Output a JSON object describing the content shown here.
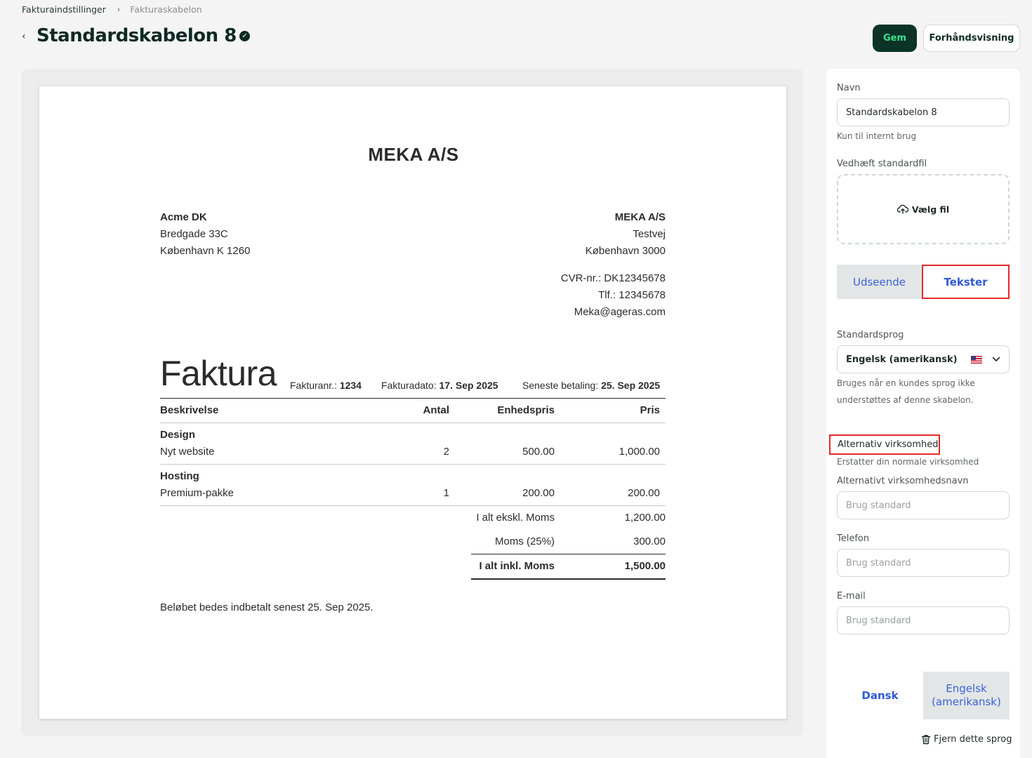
{
  "breadcrumb": {
    "root": "Fakturaindstillinger",
    "separator": "›",
    "current": "Fakturaskabelon"
  },
  "header": {
    "back": "‹",
    "title": "Standardskabelon 8",
    "verified_icon": "✓",
    "save": "Gem",
    "preview": "Forhåndsvisning"
  },
  "invoice": {
    "company_name": "MEKA A/S",
    "customer": {
      "name": "Acme DK",
      "street": "Bredgade 33C",
      "city": "København K 1260"
    },
    "sender": {
      "name": "MEKA A/S",
      "street": "Testvej",
      "city": "København 3000",
      "cvr": "CVR-nr.: DK12345678",
      "phone": "Tlf.: 12345678",
      "email": "Meka@ageras.com"
    },
    "heading": "Faktura",
    "meta": {
      "number_label": "Fakturanr.:",
      "number": "1234",
      "date_label": "Fakturadato:",
      "date": "17. Sep 2025",
      "due_label": "Seneste betaling:",
      "due": "25. Sep 2025"
    },
    "columns": {
      "description": "Beskrivelse",
      "qty": "Antal",
      "unit_price": "Enhedspris",
      "price": "Pris"
    },
    "lines": [
      {
        "group": "Design",
        "item": "Nyt website",
        "qty": "2",
        "unit_price": "500.00",
        "price": "1,000.00"
      },
      {
        "group": "Hosting",
        "item": "Premium-pakke",
        "qty": "1",
        "unit_price": "200.00",
        "price": "200.00"
      }
    ],
    "totals": {
      "subtotal_label": "I alt ekskl. Moms",
      "subtotal": "1,200.00",
      "vat_label": "Moms (25%)",
      "vat": "300.00",
      "total_label": "I alt inkl. Moms",
      "total": "1,500.00"
    },
    "footer_note": "Beløbet bedes indbetalt senest 25. Sep 2025."
  },
  "settings": {
    "name_label": "Navn",
    "name_value": "Standardskabelon 8",
    "name_hint": "Kun til internt brug",
    "attach_label": "Vedhæft standardfil",
    "attach_button": "Vælg fil",
    "tabs": [
      "Udseende",
      "Tekster"
    ],
    "active_tab": "Tekster",
    "language_label": "Standardsprog",
    "language_value": "Engelsk (amerikansk)",
    "language_hint": "Bruges når en kundes sprog ikke understøttes af denne skabelon.",
    "alt_company_title": "Alternativ virksomhed",
    "alt_company_hint": "Erstatter din normale virksomhed",
    "alt_name_label": "Alternativt virksomhedsnavn",
    "alt_name_placeholder": "Brug standard",
    "phone_label": "Telefon",
    "phone_placeholder": "Brug standard",
    "email_label": "E-mail",
    "email_placeholder": "Brug standard",
    "language_tabs": [
      "Dansk",
      "Engelsk (amerikansk)"
    ],
    "active_language_tab": "Dansk",
    "remove_language": "Fjern dette sprog"
  },
  "colors": {
    "primary_dark": "#0b3328",
    "accent_green": "#3ee48d",
    "link_blue": "#2f5bd1",
    "highlight_red": "#e32a2a"
  }
}
